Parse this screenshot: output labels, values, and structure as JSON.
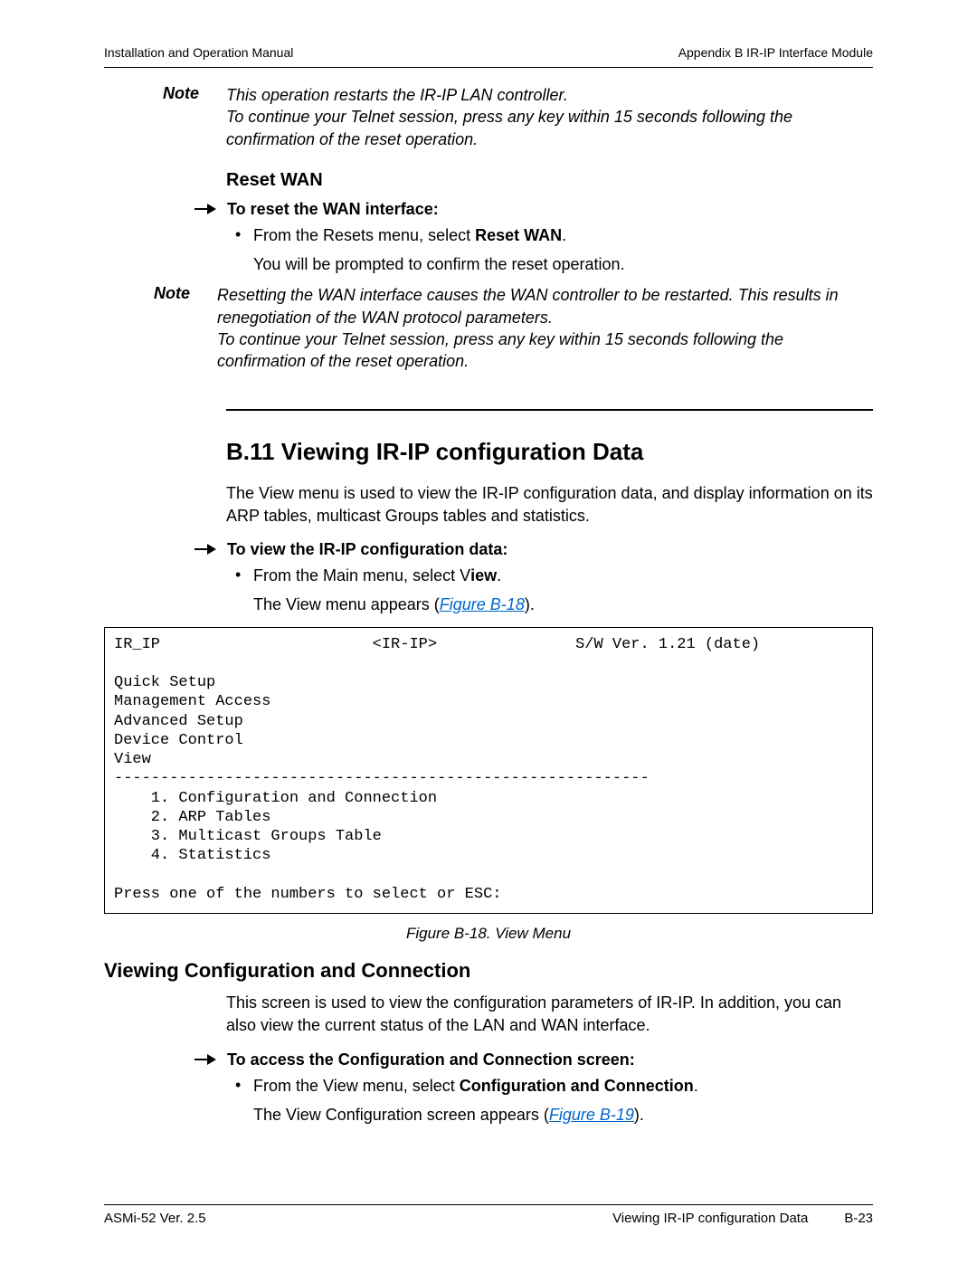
{
  "header": {
    "left": "Installation and Operation Manual",
    "right": "Appendix B  IR-IP Interface Module"
  },
  "note1": {
    "label": "Note",
    "text": "This operation restarts the IR-IP LAN controller.\nTo continue your Telnet session, press any key within 15 seconds following the confirmation of the reset operation."
  },
  "resetWan": {
    "heading": "Reset WAN",
    "procTitle": "To reset the WAN interface:",
    "bulletPre": "From the Resets menu, select ",
    "bulletBold": "Reset WAN",
    "bulletPost": ".",
    "result": "You will be prompted to confirm the reset operation."
  },
  "note2": {
    "label": "Note",
    "text": "Resetting the WAN interface causes the WAN controller to be restarted. This results in renegotiation of the WAN protocol parameters.\nTo continue your Telnet session, press any key within 15 seconds following the confirmation of the reset operation."
  },
  "sectionB11": {
    "title": "B.11     Viewing IR-IP configuration Data",
    "intro": "The View menu is used to view the IR-IP configuration data, and display information on its ARP tables, multicast Groups tables and statistics.",
    "procTitle": "To view the IR-IP configuration data:",
    "bulletPre": "From the Main menu, select V",
    "bulletBold": "iew",
    "bulletPost": ".",
    "resultPre": "The View menu appears (",
    "resultLink": "Figure B-18",
    "resultPost": ")."
  },
  "code": "IR_IP                       <IR-IP>               S/W Ver. 1.21 (date)\n\nQuick Setup\nManagement Access\nAdvanced Setup\nDevice Control\nView\n----------------------------------------------------------\n    1. Configuration and Connection\n    2. ARP Tables\n    3. Multicast Groups Table\n    4. Statistics\n\nPress one of the numbers to select or ESC:",
  "figCaption": "Figure B-18.  View Menu",
  "viewCC": {
    "heading": "Viewing Configuration and Connection",
    "intro": "This screen is used to view the configuration parameters of IR-IP. In addition, you can also view the current status of the LAN and WAN interface.",
    "procTitle": "To access the Configuration and Connection screen:",
    "bulletPre": "From the View menu, select ",
    "bulletBold": "Configuration and Connection",
    "bulletPost": ".",
    "resultPre": "The View Configuration screen appears (",
    "resultLink": "Figure B-19",
    "resultPost": ")."
  },
  "footer": {
    "left": "ASMi-52 Ver. 2.5",
    "centerRight": "Viewing IR-IP configuration Data",
    "pageNum": "B-23"
  }
}
